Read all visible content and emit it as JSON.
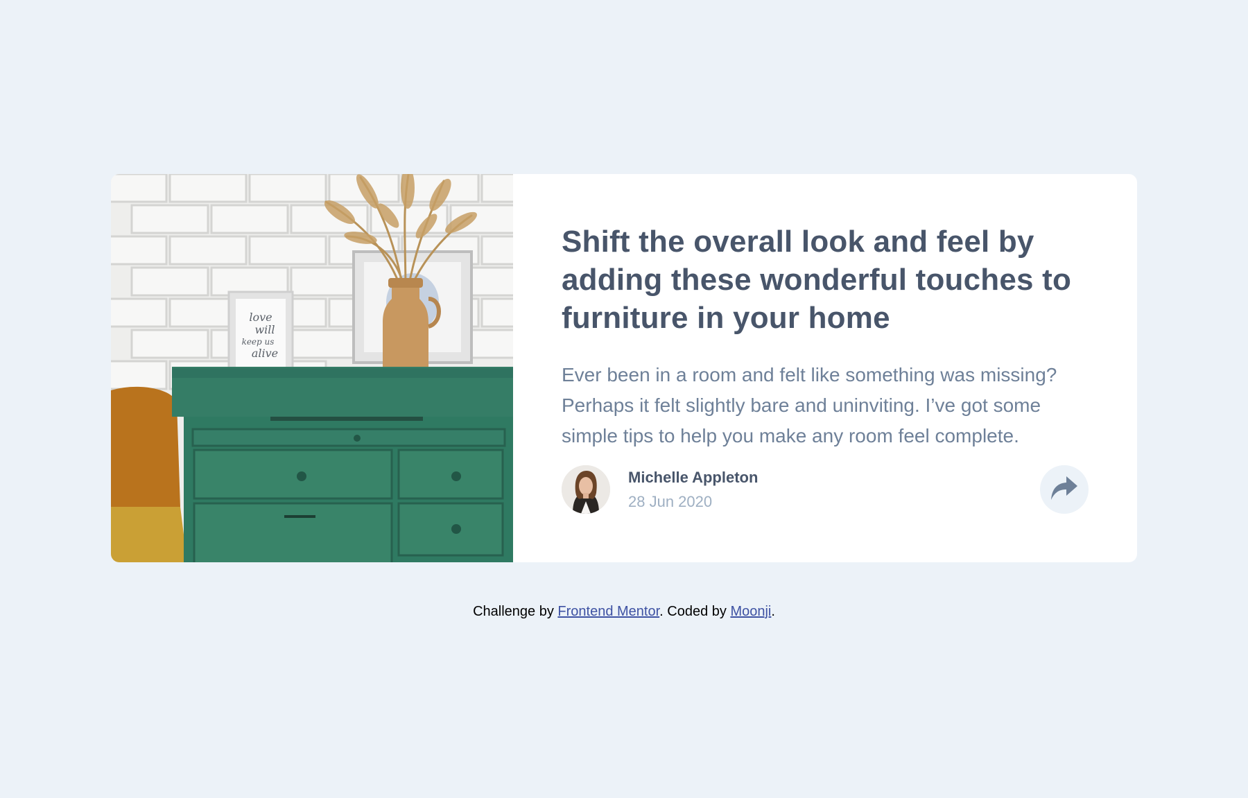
{
  "article": {
    "title": "Shift the overall look and feel by adding these wonderful touches to furniture in your home",
    "description": "Ever been in a room and felt like something was missing? Perhaps it felt slightly bare and uninviting. I’ve got some simple tips to help you make any room feel complete.",
    "image_alt": "drawers",
    "frame_text": [
      "love",
      "will",
      "keep us",
      "alive"
    ]
  },
  "author": {
    "name": "Michelle Appleton",
    "date": "28 Jun 2020"
  },
  "share": {
    "icon": "share-arrow-icon"
  },
  "attribution": {
    "prefix": "Challenge by ",
    "link1": "Frontend Mentor",
    "middle": ". Coded by ",
    "link2": "Moonji",
    "suffix": "."
  },
  "colors": {
    "background": "#ecf2f8",
    "card": "#ffffff",
    "title": "#48556a",
    "description": "#6e8098",
    "date": "#9eafc2",
    "link": "#3e52a3",
    "drawer_green": "#2f7a62"
  }
}
